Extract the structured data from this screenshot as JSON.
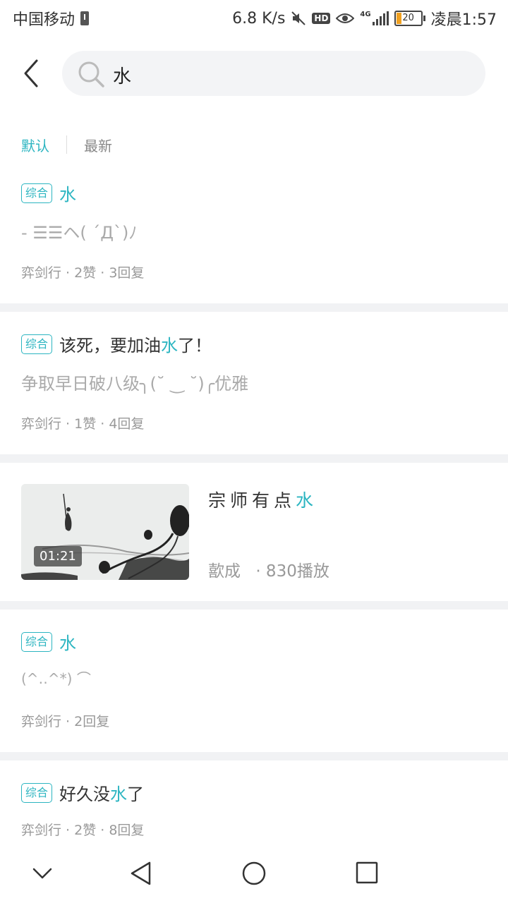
{
  "status": {
    "carrier": "中国移动",
    "speed": "6.8 K/s",
    "hd": "HD",
    "network": "4G",
    "battery": "20",
    "time": "凌晨1:57",
    "accent": "#2cb5c1"
  },
  "search": {
    "query": "水"
  },
  "sort": {
    "default": "默认",
    "latest": "最新"
  },
  "items": [
    {
      "tag": "综合",
      "title_pre": "",
      "title_hl": "水",
      "title_post": "",
      "body": "- ☰☰ヘ( ´Д`)ﾉ",
      "meta": "弈剑行 · 2赞 · 3回复"
    },
    {
      "tag": "综合",
      "title_pre": "该死，要加油",
      "title_hl": "水",
      "title_post": "了！",
      "body": "争取早日破八级╮(˘ ‿ ˘)╭优雅",
      "meta": "弈剑行 · 1赞 · 4回复"
    },
    {
      "tag": "综合",
      "title_pre": "",
      "title_hl": "水",
      "title_post": "",
      "body": "(^‥^*) ⌒",
      "meta": "弈剑行 · 2回复"
    },
    {
      "tag": "综合",
      "title_pre": "好久没",
      "title_hl": "水",
      "title_post": "了",
      "body": "",
      "meta": "弈剑行 · 2赞 · 8回复"
    }
  ],
  "video": {
    "duration": "01:21",
    "title_pre": "宗师有点",
    "title_hl": "水",
    "author": "歖成",
    "plays": "· 830播放"
  },
  "nav": {
    "icons": [
      "chevron-down-icon",
      "back-triangle-icon",
      "home-circle-icon",
      "recents-square-icon"
    ]
  }
}
